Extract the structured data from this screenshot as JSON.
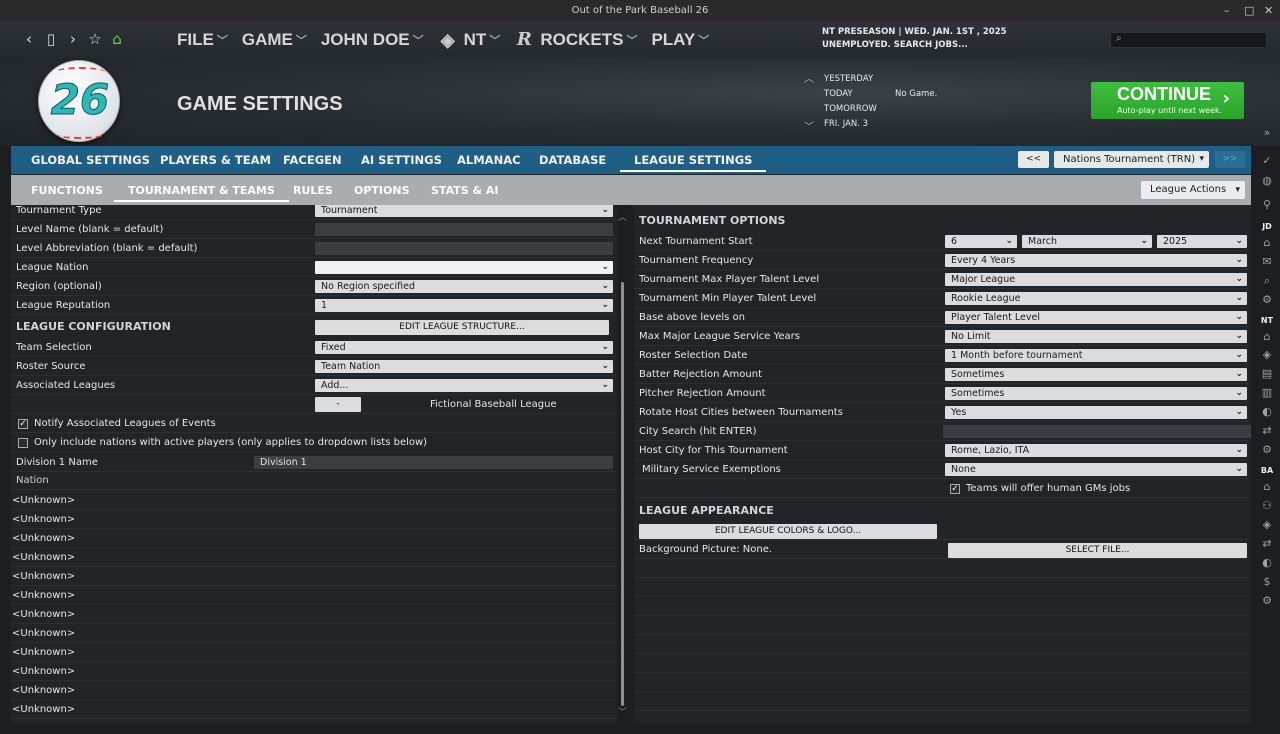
{
  "window": {
    "title": "Out of the Park Baseball 26",
    "controls": [
      "–",
      "□",
      "✕"
    ]
  },
  "nav_icons": [
    {
      "name": "back-icon",
      "glyph": "‹"
    },
    {
      "name": "device-icon",
      "glyph": "▯"
    },
    {
      "name": "forward-icon",
      "glyph": "›"
    },
    {
      "name": "star-icon",
      "glyph": "☆"
    },
    {
      "name": "home-icon",
      "glyph": "⌂"
    }
  ],
  "menu": {
    "file": "FILE",
    "game": "GAME",
    "manager": "JOHN DOE",
    "nt": "NT",
    "team": "ROCKETS",
    "play": "PLAY"
  },
  "status": {
    "line1": "NT PRESEASON  |  WED. JAN. 1ST , 2025",
    "line2": "UNEMPLOYED. SEARCH JOBS..."
  },
  "search": {
    "placeholder": ""
  },
  "logo_text": "26",
  "page_title": "GAME SETTINGS",
  "dates": {
    "yesterday": "YESTERDAY",
    "today": "TODAY",
    "today_value": "No Game.",
    "tomorrow": "TOMORROW",
    "next": "FRI. JAN. 3"
  },
  "continue": {
    "label": "CONTINUE",
    "sub": "Auto-play until next week."
  },
  "tabs1": [
    "GLOBAL SETTINGS",
    "PLAYERS & TEAM",
    "FACEGEN",
    "AI SETTINGS",
    "ALMANAC",
    "DATABASE",
    "LEAGUE SETTINGS"
  ],
  "league_nav": {
    "prev": "<<",
    "selected": "Nations Tournament (TRN)",
    "next": ">>"
  },
  "tabs2": [
    "FUNCTIONS",
    "TOURNAMENT & TEAMS",
    "RULES",
    "OPTIONS",
    "STATS & AI"
  ],
  "league_actions": "League Actions",
  "left": {
    "tournament_type_label": "Tournament Type",
    "tournament_type_value": "Tournament",
    "level_name_label": "Level Name (blank = default)",
    "level_abbr_label": "Level Abbreviation (blank = default)",
    "nation_label": "League Nation",
    "region_label": "Region (optional)",
    "region_value": "No Region specified",
    "reputation_label": "League Reputation",
    "reputation_value": "1",
    "config_header": "LEAGUE CONFIGURATION",
    "edit_structure": "EDIT LEAGUE STRUCTURE...",
    "team_selection_label": "Team Selection",
    "team_selection_value": "Fixed",
    "roster_source_label": "Roster Source",
    "roster_source_value": "Team Nation",
    "associated_label": "Associated Leagues",
    "associated_value": "Add...",
    "minus_btn": "-",
    "fictional": "Fictional Baseball League",
    "notify": "Notify Associated Leagues of Events",
    "only_include": "Only include nations with active players (only applies to dropdown lists below)",
    "division_label": "Division 1 Name",
    "division_value": "Division 1",
    "nation_header": "Nation",
    "nations": [
      "<Unknown>",
      "<Unknown>",
      "<Unknown>",
      "<Unknown>",
      "<Unknown>",
      "<Unknown>",
      "<Unknown>",
      "<Unknown>",
      "<Unknown>",
      "<Unknown>",
      "<Unknown>",
      "<Unknown>"
    ]
  },
  "right": {
    "header": "TOURNAMENT OPTIONS",
    "next_start_label": "Next Tournament Start",
    "next_day": "6",
    "next_month": "March",
    "next_year": "2025",
    "frequency_label": "Tournament Frequency",
    "frequency_value": "Every 4 Years",
    "max_talent_label": "Tournament Max Player Talent Level",
    "max_talent_value": "Major League",
    "min_talent_label": "Tournament Min Player Talent Level",
    "min_talent_value": "Rookie League",
    "base_label": "Base above levels on",
    "base_value": "Player Talent Level",
    "max_service_label": "Max Major League Service Years",
    "max_service_value": "No Limit",
    "roster_date_label": "Roster Selection Date",
    "roster_date_value": "1 Month before tournament",
    "batter_label": "Batter Rejection Amount",
    "batter_value": "Sometimes",
    "pitcher_label": "Pitcher Rejection Amount",
    "pitcher_value": "Sometimes",
    "rotate_label": "Rotate Host Cities between Tournaments",
    "rotate_value": "Yes",
    "city_search_label": "City Search (hit ENTER)",
    "host_city_label": "Host City for This Tournament",
    "host_city_value": "Rome, Lazio, ITA",
    "military_label": "Military Service Exemptions",
    "military_value": "None",
    "gm_jobs": "Teams will offer human GMs jobs",
    "appearance_header": "LEAGUE APPEARANCE",
    "edit_colors": "EDIT LEAGUE COLORS & LOGO...",
    "bg_picture": "Background Picture: None.",
    "select_file": "SELECT FILE..."
  },
  "sidebar": {
    "jd": "JD",
    "nt": "NT",
    "ba": "BA"
  },
  "colors": {
    "tab_blue": "#1f5f86",
    "continue_green": "#34b334",
    "subtab_gray": "#a9adb0"
  }
}
